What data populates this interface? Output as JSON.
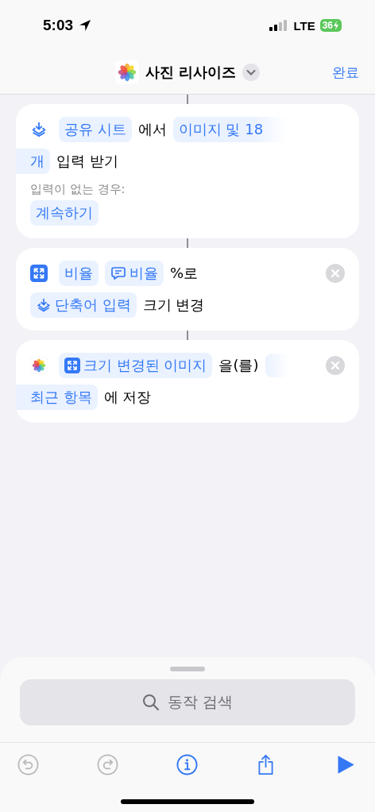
{
  "status_bar": {
    "time": "5:03",
    "network": "LTE",
    "battery": "36"
  },
  "nav": {
    "title": "사진 리사이즈",
    "done": "완료"
  },
  "actions": [
    {
      "kind": "receive",
      "removable": false,
      "lines": [
        [
          {
            "kind": "token",
            "text": "공유 시트"
          },
          {
            "kind": "text",
            "text": "에서"
          },
          {
            "kind": "token",
            "text": "이미지 및 18",
            "fade": true
          }
        ],
        [
          {
            "kind": "token",
            "text": "개",
            "edge": true
          },
          {
            "kind": "text",
            "text": "입력 받기"
          }
        ]
      ],
      "note": "입력이 없는 경우:",
      "note_token": "계속하기"
    },
    {
      "kind": "resize",
      "removable": true,
      "lines": [
        [
          {
            "kind": "token",
            "text": "비율"
          },
          {
            "kind": "ask_token",
            "text": "비율"
          },
          {
            "kind": "text",
            "text": "%로"
          }
        ],
        [
          {
            "kind": "input_token",
            "text": "단축어 입력"
          },
          {
            "kind": "text",
            "text": "크기 변경"
          }
        ]
      ]
    },
    {
      "kind": "save",
      "removable": true,
      "lines": [
        [
          {
            "kind": "image_token",
            "text": "크기 변경된 이미지"
          },
          {
            "kind": "text",
            "text": "을(를)"
          },
          {
            "kind": "blank"
          }
        ],
        [
          {
            "kind": "token",
            "text": "최근 항목",
            "edge": true
          },
          {
            "kind": "text",
            "text": "에 저장"
          }
        ]
      ]
    }
  ],
  "search": {
    "placeholder": "동작 검색"
  },
  "toolbar": [
    {
      "kind": "undo",
      "disabled": true
    },
    {
      "kind": "redo",
      "disabled": true
    },
    {
      "kind": "info",
      "disabled": false
    },
    {
      "kind": "share",
      "disabled": false
    },
    {
      "kind": "run",
      "disabled": false
    }
  ]
}
